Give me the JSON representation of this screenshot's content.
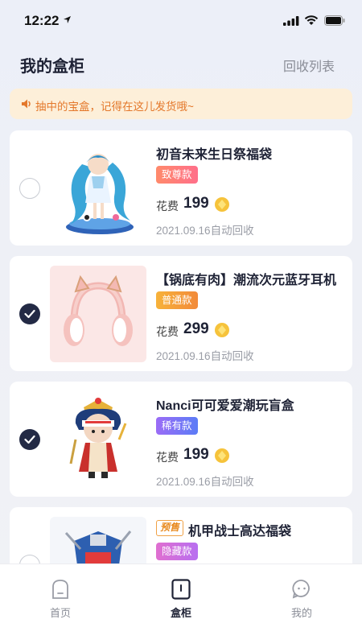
{
  "status": {
    "time": "12:22"
  },
  "header": {
    "title": "我的盒柜",
    "recycle_list": "回收列表"
  },
  "notice": {
    "text": "抽中的宝盒，记得在这儿发货哦~"
  },
  "items": [
    {
      "name": "初音未来生日祭福袋",
      "tag": "致尊款",
      "tag_color": "#ff7a6b",
      "price_label": "花费",
      "price": "199",
      "date": "2021.09.16自动回收",
      "checked": false,
      "presale": ""
    },
    {
      "name": "【锅底有肉】潮流次元蓝牙耳机",
      "tag": "普通款",
      "tag_color": "#f3a23a",
      "price_label": "花费",
      "price": "299",
      "date": "2021.09.16自动回收",
      "checked": true,
      "presale": ""
    },
    {
      "name": "Nanci可可爱爱潮玩盲盒",
      "tag": "稀有款",
      "tag_color": "#7b6cf6",
      "price_label": "花费",
      "price": "199",
      "date": "2021.09.16自动回收",
      "checked": true,
      "presale": ""
    },
    {
      "name": "机甲战士高达福袋",
      "tag": "隐藏款",
      "tag_color": "#d16fe0",
      "price_label": "",
      "price": "",
      "date": "",
      "checked": false,
      "presale": "预售"
    }
  ],
  "tabbar": {
    "home": "首页",
    "cabinet": "盒柜",
    "mine": "我的"
  },
  "colors": {
    "accent": "#232a45",
    "notice_bg": "#fdefd9",
    "notice_text": "#e4782b",
    "coin": "#f6c33b"
  }
}
